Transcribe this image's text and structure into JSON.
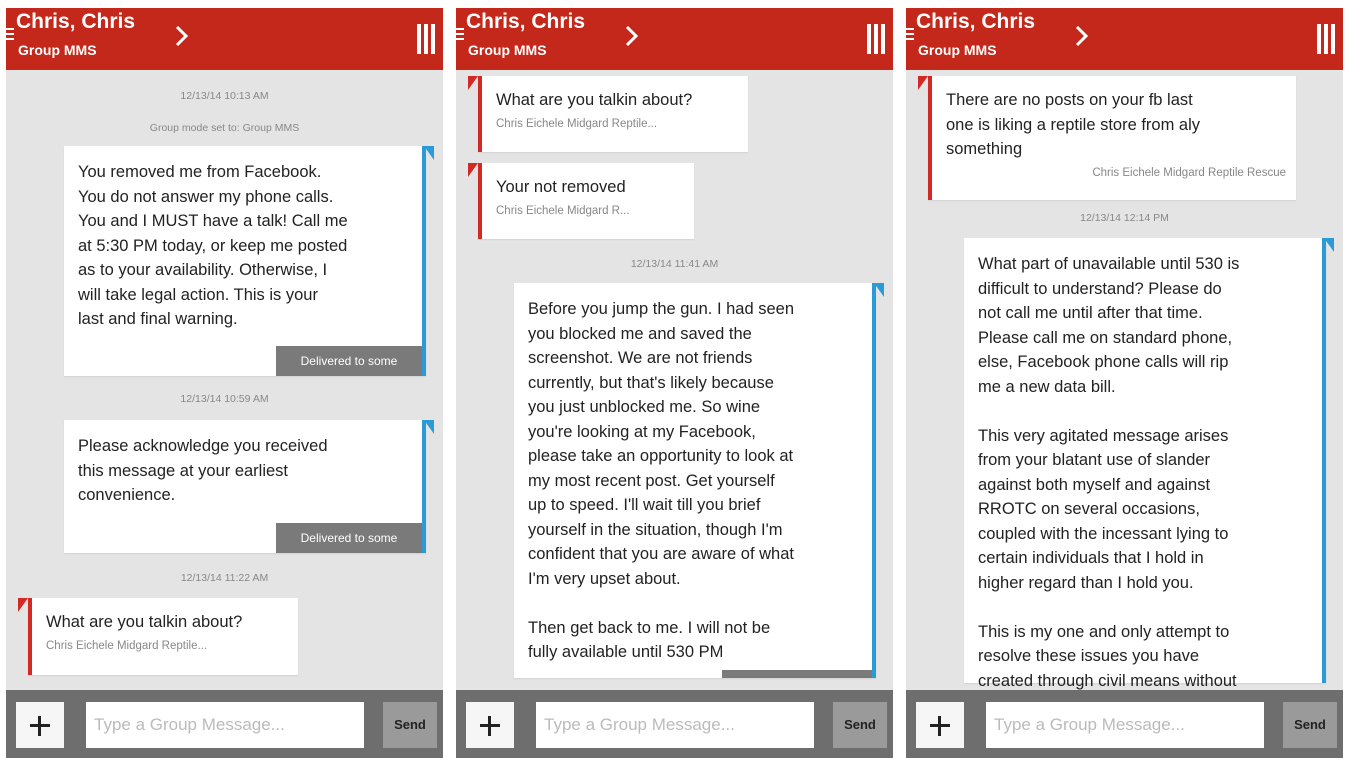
{
  "colors": {
    "header": "#c4281a",
    "sent_accent": "#2a9bd7",
    "received_accent": "#d22a22",
    "background": "#e4e4e4",
    "footer": "#6e6e6e"
  },
  "header": {
    "title": "Chris, Chris",
    "subtitle": "Group MMS",
    "menu_icon": "hamburger-icon",
    "chevron_icon": "chevron-right-icon",
    "overflow_icon": "vertical-bars-icon"
  },
  "composer": {
    "plus_icon": "plus-icon",
    "placeholder": "Type a Group Message...",
    "send_label": "Send"
  },
  "panels": [
    {
      "timestamp_1": "12/13/14 10:13 AM",
      "group_mode": "Group mode set to: Group MMS",
      "msg_1": "You removed me from Facebook.\nYou do not answer my phone calls.\nYou and I MUST have a talk! Call me\nat 5:30 PM today, or keep me posted\nas to your availability. Otherwise, I\nwill take legal action. This is your\nlast and final warning.",
      "msg_1_status": "Delivered to some",
      "timestamp_2": "12/13/14 10:59 AM",
      "msg_2": "Please acknowledge you received\nthis message at your earliest\nconvenience.",
      "msg_2_status": "Delivered to some",
      "timestamp_3": "12/13/14 11:22 AM",
      "msg_3": "What are you talkin about?",
      "msg_3_sender": "Chris Eichele Midgard Reptile..."
    },
    {
      "msg_1": "What are you talkin about?",
      "msg_1_sender": "Chris Eichele Midgard Reptile...",
      "msg_2": "Your not removed",
      "msg_2_sender": "Chris Eichele Midgard R...",
      "timestamp_1": "12/13/14 11:41 AM",
      "msg_3": "Before you jump the gun. I had seen\nyou blocked me and saved the\nscreenshot. We are not friends\ncurrently, but that's likely because\nyou just unblocked me. So wine\nyou're looking at my Facebook,\nplease take an opportunity to look at\nmy most recent post. Get yourself\nup to speed. I'll wait till you brief\nyourself in the situation, though I'm\nconfident that you are aware of what\nI'm very upset about.\n\nThen get back to me. I will not be\nfully available until 530 PM"
    },
    {
      "msg_1": "There are no posts on your fb last\none is liking a reptile store from aly\nsomething",
      "msg_1_sender": "Chris Eichele Midgard Reptile Rescue",
      "timestamp_1": "12/13/14 12:14 PM",
      "msg_2": "What part of unavailable until 530 is\ndifficult to understand? Please do\nnot call me until after that time.\nPlease call me on standard phone,\nelse, Facebook phone calls will rip\nme a new data bill.\n\nThis very agitated message arises\nfrom your blatant use of slander\nagainst both myself and against\nRROTC on several occasions,\ncoupled with the incessant lying to\ncertain individuals that I hold in\nhigher regard than I hold you.\n\nThis is my one and only attempt to\nresolve these issues you have\ncreated through civil means without"
    }
  ]
}
